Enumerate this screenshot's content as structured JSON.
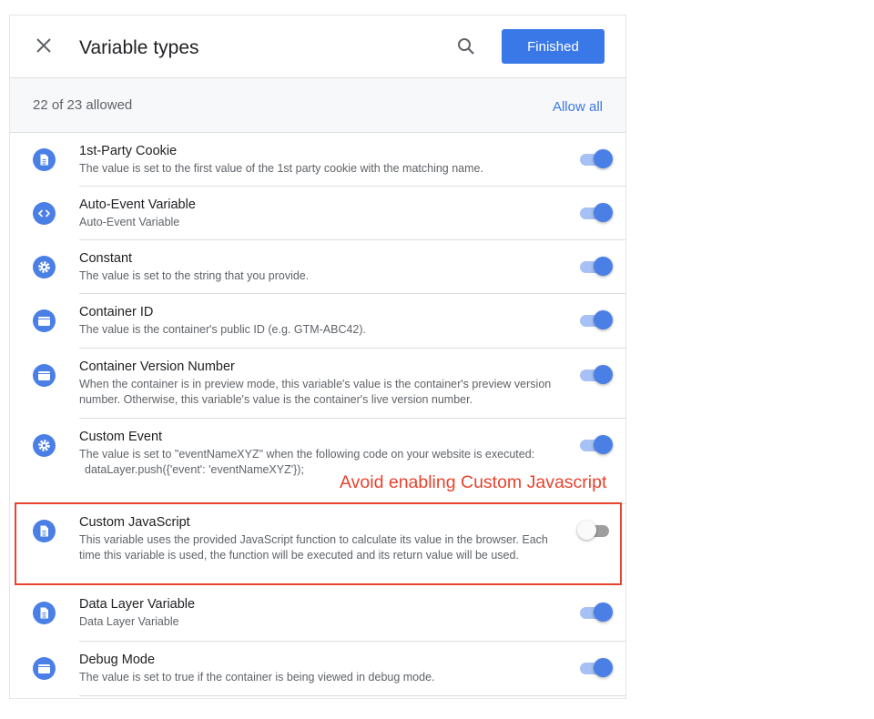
{
  "header": {
    "title": "Variable types",
    "finished_label": "Finished",
    "close_icon": "close-icon",
    "search_icon": "search-icon"
  },
  "summary": {
    "count_text": "22 of 23 allowed",
    "allow_all_label": "Allow all"
  },
  "colors": {
    "accent": "#3b78e7",
    "annotation": "#e8432e",
    "toggle_on_track": "#a7c1f5",
    "toggle_off_track": "#9e9e9e"
  },
  "items": [
    {
      "name": "1st-Party Cookie",
      "description": "The value is set to the first value of the 1st party cookie with the matching name.",
      "icon": "document-icon",
      "enabled": true
    },
    {
      "name": "Auto-Event Variable",
      "description": "Auto-Event Variable",
      "icon": "code-icon",
      "enabled": true
    },
    {
      "name": "Constant",
      "description": "The value is set to the string that you provide.",
      "icon": "gear-icon",
      "enabled": true
    },
    {
      "name": "Container ID",
      "description": "The value is the container's public ID (e.g. GTM-ABC42).",
      "icon": "container-icon",
      "enabled": true
    },
    {
      "name": "Container Version Number",
      "description": "When the container is in preview mode, this variable's value is the container's preview version number. Otherwise, this variable's value is the container's live version number.",
      "icon": "container-icon",
      "enabled": true
    },
    {
      "name": "Custom Event",
      "description": "The value is set to \"eventNameXYZ\" when the following code on your website is executed:",
      "code": "dataLayer.push({'event': 'eventNameXYZ'});",
      "icon": "gear-icon",
      "enabled": true
    },
    {
      "name": "Custom JavaScript",
      "description": "This variable uses the provided JavaScript function to calculate its value in the browser. Each time this variable is used, the function will be executed and its return value will be used.",
      "icon": "document-icon",
      "enabled": false
    },
    {
      "name": "Data Layer Variable",
      "description": "Data Layer Variable",
      "icon": "document-icon",
      "enabled": true
    },
    {
      "name": "Debug Mode",
      "description": "The value is set to true if the container is being viewed in debug mode.",
      "icon": "container-icon",
      "enabled": true
    }
  ],
  "annotation": {
    "text": "Avoid enabling Custom Javascript"
  }
}
